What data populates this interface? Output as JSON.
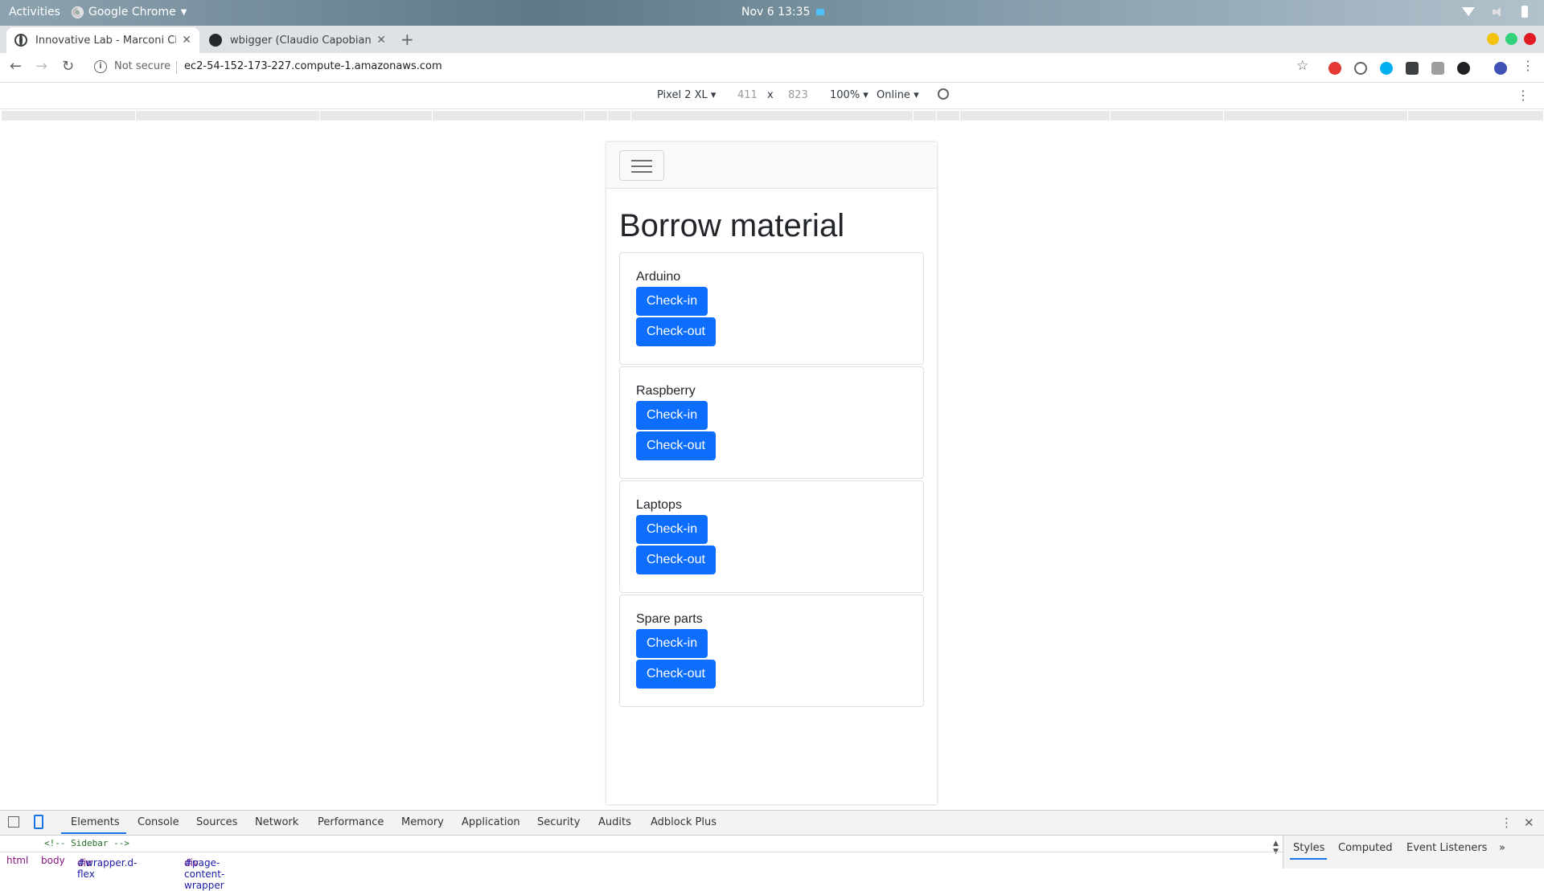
{
  "desktop": {
    "activities": "Activities",
    "app_name": "Google Chrome",
    "clock": "Nov 6  13:35"
  },
  "browser": {
    "tabs": [
      {
        "title": "Innovative Lab - Marconi Civit",
        "active": true
      },
      {
        "title": "wbigger (Claudio Capobianco",
        "active": false
      }
    ],
    "security_label": "Not secure",
    "url": "ec2-54-152-173-227.compute-1.amazonaws.com",
    "device_toolbar": {
      "device": "Pixel 2 XL",
      "width": "411",
      "times": "x",
      "height": "823",
      "zoom": "100%",
      "throttle": "Online"
    }
  },
  "page": {
    "heading": "Borrow material",
    "items": [
      {
        "name": "Arduino",
        "checkin": "Check-in",
        "checkout": "Check-out"
      },
      {
        "name": "Raspberry",
        "checkin": "Check-in",
        "checkout": "Check-out"
      },
      {
        "name": "Laptops",
        "checkin": "Check-in",
        "checkout": "Check-out"
      },
      {
        "name": "Spare parts",
        "checkin": "Check-in",
        "checkout": "Check-out"
      }
    ],
    "button_color": "#0d6efd"
  },
  "devtools": {
    "tabs": [
      "Elements",
      "Console",
      "Sources",
      "Network",
      "Performance",
      "Memory",
      "Application",
      "Security",
      "Audits",
      "Adblock Plus"
    ],
    "code_line": "<!-- Sidebar -->",
    "breadcrumbs": {
      "html": "html",
      "body": "body",
      "wrapper_tag": "div",
      "wrapper_id": "#wrapper.d-flex",
      "content_tag": "div",
      "content_id": "#page-content-wrapper"
    },
    "styles_tabs": [
      "Styles",
      "Computed",
      "Event Listeners"
    ]
  }
}
